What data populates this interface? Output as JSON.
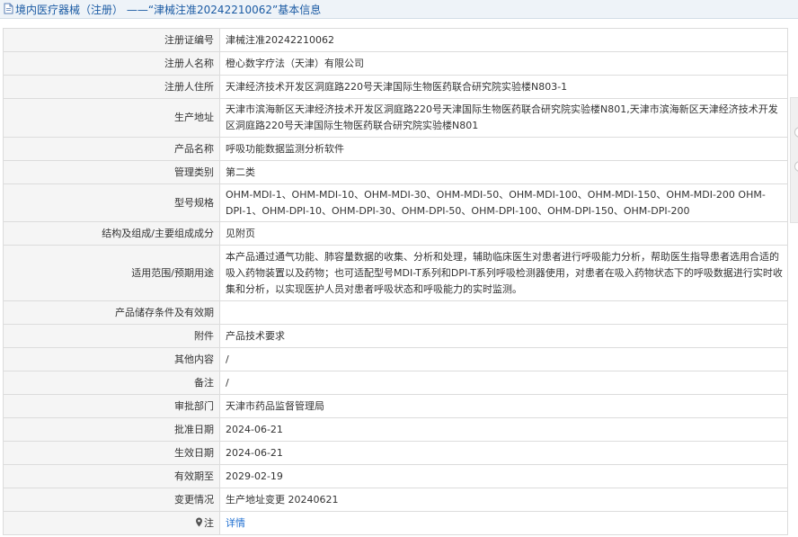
{
  "header": {
    "icon": "document-icon",
    "title": "境内医疗器械（注册） ——“津械注准20242210062”基本信息"
  },
  "rows": [
    {
      "label": "注册证编号",
      "value": "津械注准20242210062"
    },
    {
      "label": "注册人名称",
      "value": "橙心数字疗法（天津）有限公司"
    },
    {
      "label": "注册人住所",
      "value": "天津经济技术开发区洞庭路220号天津国际生物医药联合研究院实验楼N803-1"
    },
    {
      "label": "生产地址",
      "value": "天津市滨海新区天津经济技术开发区洞庭路220号天津国际生物医药联合研究院实验楼N801,天津市滨海新区天津经济技术开发区洞庭路220号天津国际生物医药联合研究院实验楼N801"
    },
    {
      "label": "产品名称",
      "value": "呼吸功能数据监测分析软件"
    },
    {
      "label": "管理类别",
      "value": "第二类"
    },
    {
      "label": "型号规格",
      "value": "OHM-MDI-1、OHM-MDI-10、OHM-MDI-30、OHM-MDI-50、OHM-MDI-100、OHM-MDI-150、OHM-MDI-200 OHM-DPI-1、OHM-DPI-10、OHM-DPI-30、OHM-DPI-50、OHM-DPI-100、OHM-DPI-150、OHM-DPI-200"
    },
    {
      "label": "结构及组成/主要组成成分",
      "value": "见附页"
    },
    {
      "label": "适用范围/预期用途",
      "value": "本产品通过通气功能、肺容量数据的收集、分析和处理，辅助临床医生对患者进行呼吸能力分析，帮助医生指导患者选用合适的吸入药物装置以及药物；也可适配型号MDI-T系列和DPI-T系列呼吸检测器使用，对患者在吸入药物状态下的呼吸数据进行实时收集和分析，以实现医护人员对患者呼吸状态和呼吸能力的实时监测。"
    },
    {
      "label": "产品储存条件及有效期",
      "value": ""
    },
    {
      "label": "附件",
      "value": "产品技术要求"
    },
    {
      "label": "其他内容",
      "value": "/"
    },
    {
      "label": "备注",
      "value": "/"
    },
    {
      "label": "审批部门",
      "value": "天津市药品监督管理局"
    },
    {
      "label": "批准日期",
      "value": "2024-06-21"
    },
    {
      "label": "生效日期",
      "value": "2024-06-21"
    },
    {
      "label": "有效期至",
      "value": "2029-02-19"
    },
    {
      "label": "变更情况",
      "value": "生产地址变更 20240621"
    }
  ],
  "note_row": {
    "label": "注",
    "icon": "map-pin-icon",
    "link": "详情"
  },
  "colors": {
    "title": "#1a5aa3",
    "link": "#1f6fd1",
    "label_bg": "#f5f5f5",
    "border": "#dcdcdc"
  }
}
